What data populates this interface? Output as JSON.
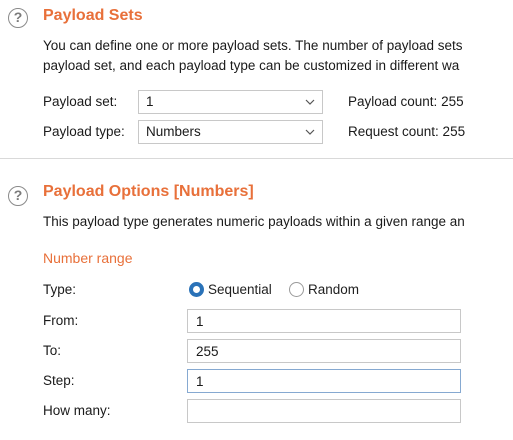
{
  "payload_sets": {
    "title": "Payload Sets",
    "description_line1": "You can define one or more payload sets. The number of payload sets",
    "description_line2": "payload set, and each payload type can be customized in different wa",
    "set_label": "Payload set:",
    "set_value": "1",
    "type_label": "Payload type:",
    "type_value": "Numbers",
    "payload_count": "Payload count: 255",
    "request_count": "Request count: 255"
  },
  "payload_options": {
    "title": "Payload Options [Numbers]",
    "description": "This payload type generates numeric payloads within a given range an",
    "number_range": {
      "heading": "Number range",
      "type_label": "Type:",
      "options": [
        "Sequential",
        "Random"
      ],
      "selected": "Sequential",
      "from_label": "From:",
      "from_value": "1",
      "to_label": "To:",
      "to_value": "255",
      "step_label": "Step:",
      "step_value": "1",
      "how_many_label": "How many:",
      "how_many_value": ""
    }
  },
  "icons": {
    "help": "?"
  },
  "colors": {
    "accent": "#e8703a",
    "radio_selected": "#2a72b8",
    "focused_border": "#86a9d1"
  }
}
